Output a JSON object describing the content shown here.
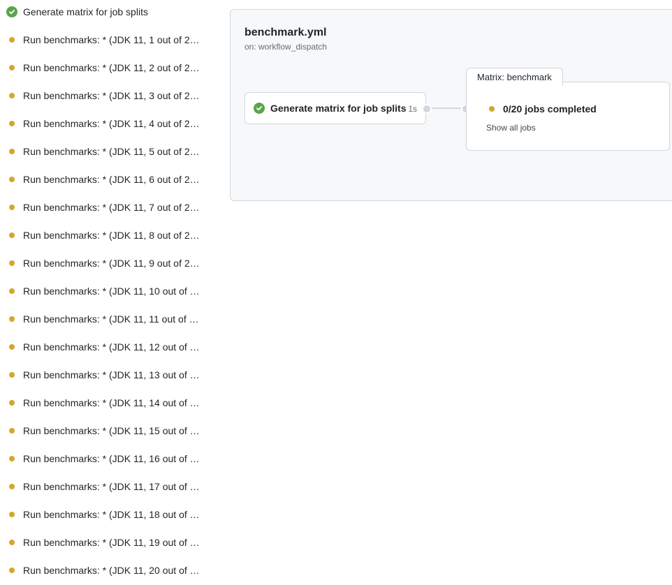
{
  "sidebar": {
    "items": [
      {
        "label": "Generate matrix for job splits",
        "status": "success"
      },
      {
        "label": "Run benchmarks: * (JDK 11, 1 out of 2…",
        "status": "queued"
      },
      {
        "label": "Run benchmarks: * (JDK 11, 2 out of 2…",
        "status": "queued"
      },
      {
        "label": "Run benchmarks: * (JDK 11, 3 out of 2…",
        "status": "queued"
      },
      {
        "label": "Run benchmarks: * (JDK 11, 4 out of 2…",
        "status": "queued"
      },
      {
        "label": "Run benchmarks: * (JDK 11, 5 out of 2…",
        "status": "queued"
      },
      {
        "label": "Run benchmarks: * (JDK 11, 6 out of 2…",
        "status": "queued"
      },
      {
        "label": "Run benchmarks: * (JDK 11, 7 out of 2…",
        "status": "queued"
      },
      {
        "label": "Run benchmarks: * (JDK 11, 8 out of 2…",
        "status": "queued"
      },
      {
        "label": "Run benchmarks: * (JDK 11, 9 out of 2…",
        "status": "queued"
      },
      {
        "label": "Run benchmarks: * (JDK 11, 10 out of …",
        "status": "queued"
      },
      {
        "label": "Run benchmarks: * (JDK 11, 11 out of …",
        "status": "queued"
      },
      {
        "label": "Run benchmarks: * (JDK 11, 12 out of …",
        "status": "queued"
      },
      {
        "label": "Run benchmarks: * (JDK 11, 13 out of …",
        "status": "queued"
      },
      {
        "label": "Run benchmarks: * (JDK 11, 14 out of …",
        "status": "queued"
      },
      {
        "label": "Run benchmarks: * (JDK 11, 15 out of …",
        "status": "queued"
      },
      {
        "label": "Run benchmarks: * (JDK 11, 16 out of …",
        "status": "queued"
      },
      {
        "label": "Run benchmarks: * (JDK 11, 17 out of …",
        "status": "queued"
      },
      {
        "label": "Run benchmarks: * (JDK 11, 18 out of …",
        "status": "queued"
      },
      {
        "label": "Run benchmarks: * (JDK 11, 19 out of …",
        "status": "queued"
      },
      {
        "label": "Run benchmarks: * (JDK 11, 20 out of …",
        "status": "queued"
      }
    ]
  },
  "graph": {
    "workflow_title": "benchmark.yml",
    "trigger": "on: workflow_dispatch",
    "job": {
      "label": "Generate matrix for job splits",
      "duration": "1s"
    },
    "matrix": {
      "tab_label": "Matrix: benchmark",
      "jobs_completed": "0/20 jobs completed",
      "show_all": "Show all jobs"
    }
  },
  "colors": {
    "success": "#57a64a",
    "queued": "#d4a72c",
    "border": "#d0d7de",
    "panel_bg": "#f6f8fa"
  },
  "icons": {
    "success": "check-circle-icon",
    "queued": "queued-dot-icon"
  }
}
